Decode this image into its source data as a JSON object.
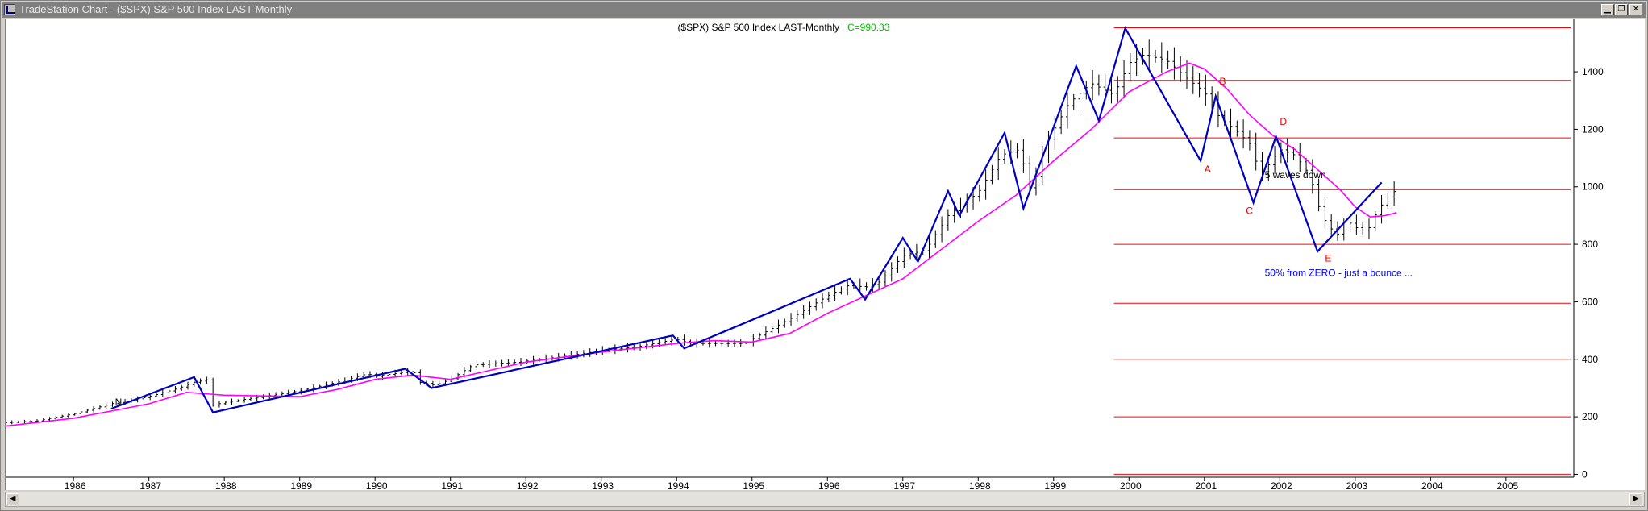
{
  "window": {
    "title": "TradeStation Chart - ($SPX) S&P 500 Index LAST-Monthly",
    "min_icon": "minimize-icon",
    "restore_icon": "restore-icon",
    "close_icon": "close-icon"
  },
  "chart_data": {
    "type": "bar",
    "title": "($SPX) S&P 500 Index LAST-Monthly",
    "close_label": "C=990.33",
    "close_value": 990.33,
    "xlim": [
      1985.1,
      2005.9
    ],
    "ylim": [
      -10,
      1560
    ],
    "x_ticks": [
      1986,
      1987,
      1988,
      1989,
      1990,
      1991,
      1992,
      1993,
      1994,
      1995,
      1996,
      1997,
      1998,
      1999,
      2000,
      2001,
      2002,
      2003,
      2004,
      2005
    ],
    "x_tick_labels": [
      "1986",
      "1987",
      "1988",
      "1989",
      "1990",
      "1991",
      "1992",
      "1993",
      "1994",
      "1995",
      "1996",
      "1997",
      "1998",
      "1999",
      "2000",
      "2001",
      "2002",
      "2003",
      "2004",
      "2005"
    ],
    "y_ticks": [
      0,
      200,
      400,
      600,
      800,
      1000,
      1200,
      1400
    ],
    "y_tick_labels": [
      "0",
      "200",
      "400",
      "600",
      "800",
      "1000",
      "1200",
      "1400"
    ],
    "price_path": [
      [
        1985.1,
        180
      ],
      [
        1985.5,
        185
      ],
      [
        1986.0,
        210
      ],
      [
        1986.5,
        245
      ],
      [
        1987.0,
        270
      ],
      [
        1987.4,
        300
      ],
      [
        1987.6,
        320
      ],
      [
        1987.8,
        330
      ],
      [
        1987.85,
        240
      ],
      [
        1988.0,
        250
      ],
      [
        1988.5,
        270
      ],
      [
        1989.0,
        290
      ],
      [
        1989.5,
        320
      ],
      [
        1989.9,
        350
      ],
      [
        1990.0,
        340
      ],
      [
        1990.5,
        360
      ],
      [
        1990.6,
        320
      ],
      [
        1990.8,
        310
      ],
      [
        1991.0,
        330
      ],
      [
        1991.3,
        380
      ],
      [
        1991.9,
        390
      ],
      [
        1992.5,
        410
      ],
      [
        1993.0,
        430
      ],
      [
        1993.5,
        445
      ],
      [
        1994.0,
        470
      ],
      [
        1994.2,
        455
      ],
      [
        1994.5,
        455
      ],
      [
        1994.9,
        455
      ],
      [
        1995.0,
        470
      ],
      [
        1995.5,
        540
      ],
      [
        1996.0,
        620
      ],
      [
        1996.3,
        660
      ],
      [
        1996.5,
        650
      ],
      [
        1996.7,
        670
      ],
      [
        1997.0,
        760
      ],
      [
        1997.3,
        780
      ],
      [
        1997.6,
        900
      ],
      [
        1997.9,
        960
      ],
      [
        1998.0,
        980
      ],
      [
        1998.3,
        1110
      ],
      [
        1998.55,
        1130
      ],
      [
        1998.7,
        980
      ],
      [
        1998.9,
        1150
      ],
      [
        1999.2,
        1290
      ],
      [
        1999.5,
        1360
      ],
      [
        1999.8,
        1320
      ],
      [
        2000.0,
        1430
      ],
      [
        2000.2,
        1460
      ],
      [
        2000.5,
        1440
      ],
      [
        2000.8,
        1370
      ],
      [
        2001.0,
        1330
      ],
      [
        2001.2,
        1240
      ],
      [
        2001.4,
        1200
      ],
      [
        2001.6,
        1150
      ],
      [
        2001.75,
        1040
      ],
      [
        2002.0,
        1130
      ],
      [
        2002.2,
        1110
      ],
      [
        2002.4,
        1040
      ],
      [
        2002.55,
        900
      ],
      [
        2002.75,
        830
      ],
      [
        2002.9,
        880
      ],
      [
        2003.0,
        860
      ],
      [
        2003.15,
        840
      ],
      [
        2003.3,
        920
      ],
      [
        2003.45,
        970
      ],
      [
        2003.55,
        990
      ]
    ],
    "moving_average": [
      [
        1985.0,
        165
      ],
      [
        1986.0,
        195
      ],
      [
        1987.0,
        245
      ],
      [
        1987.5,
        285
      ],
      [
        1988.0,
        275
      ],
      [
        1989.0,
        270
      ],
      [
        1989.5,
        295
      ],
      [
        1990.0,
        330
      ],
      [
        1990.5,
        345
      ],
      [
        1991.0,
        330
      ],
      [
        1991.5,
        360
      ],
      [
        1992.0,
        390
      ],
      [
        1993.0,
        425
      ],
      [
        1994.0,
        455
      ],
      [
        1994.5,
        465
      ],
      [
        1995.0,
        460
      ],
      [
        1995.5,
        490
      ],
      [
        1996.0,
        560
      ],
      [
        1996.5,
        620
      ],
      [
        1997.0,
        680
      ],
      [
        1997.5,
        780
      ],
      [
        1998.0,
        880
      ],
      [
        1998.5,
        970
      ],
      [
        1999.0,
        1090
      ],
      [
        1999.5,
        1200
      ],
      [
        2000.0,
        1330
      ],
      [
        2000.5,
        1400
      ],
      [
        2000.8,
        1430
      ],
      [
        2001.0,
        1410
      ],
      [
        2001.3,
        1340
      ],
      [
        2001.6,
        1250
      ],
      [
        2001.9,
        1180
      ],
      [
        2002.2,
        1130
      ],
      [
        2002.5,
        1060
      ],
      [
        2002.8,
        990
      ],
      [
        2003.0,
        930
      ],
      [
        2003.2,
        895
      ],
      [
        2003.4,
        900
      ],
      [
        2003.55,
        910
      ]
    ],
    "wave_path": [
      [
        1986.5,
        228
      ],
      [
        1987.6,
        338
      ],
      [
        1987.85,
        215
      ],
      [
        1990.4,
        367
      ],
      [
        1990.75,
        300
      ],
      [
        1993.95,
        483
      ],
      [
        1994.1,
        438
      ],
      [
        1996.3,
        680
      ],
      [
        1996.5,
        608
      ],
      [
        1997.0,
        822
      ],
      [
        1997.2,
        740
      ],
      [
        1997.6,
        985
      ],
      [
        1997.75,
        900
      ],
      [
        1998.35,
        1188
      ],
      [
        1998.6,
        925
      ],
      [
        1999.3,
        1420
      ],
      [
        1999.6,
        1230
      ],
      [
        1999.95,
        1552
      ],
      [
        2000.95,
        1090
      ],
      [
        2001.15,
        1315
      ],
      [
        2001.65,
        945
      ],
      [
        2001.95,
        1175
      ],
      [
        2002.5,
        775
      ],
      [
        2003.35,
        1015
      ]
    ],
    "horizontal_levels": [
      0,
      200,
      400,
      595,
      800,
      990,
      1170,
      1370,
      1553
    ],
    "levels_start_x": 1999.8,
    "annotations": [
      {
        "text": "A",
        "x": 2001.0,
        "y": 1050,
        "color": "#e00000"
      },
      {
        "text": "B",
        "x": 2001.2,
        "y": 1355,
        "color": "#e00000"
      },
      {
        "text": "C",
        "x": 2001.55,
        "y": 905,
        "color": "#e00000"
      },
      {
        "text": "D",
        "x": 2002.0,
        "y": 1215,
        "color": "#e00000"
      },
      {
        "text": "E",
        "x": 2002.6,
        "y": 740,
        "color": "#e00000"
      },
      {
        "text": "5 waves down",
        "x": 2001.8,
        "y": 1030,
        "color": "#000000"
      },
      {
        "text": "50% from ZERO - just a bounce ...",
        "x": 2001.8,
        "y": 690,
        "color": "#0000ff"
      },
      {
        "text": "N",
        "x": 1986.55,
        "y": 240,
        "color": "#000000"
      }
    ],
    "colors": {
      "price_bars": "#000000",
      "moving_average": "#ff00ff",
      "wave": "#0000c0",
      "levels": "#ff0000",
      "close_label": "#00c000"
    }
  }
}
